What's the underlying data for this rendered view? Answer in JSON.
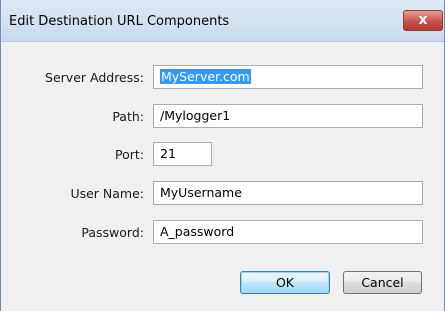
{
  "dialog": {
    "title": "Edit Destination URL Components",
    "close_label": "x"
  },
  "form": {
    "server_address": {
      "label": "Server Address:",
      "value": "MyServer.com"
    },
    "path": {
      "label": "Path:",
      "value": "/Mylogger1"
    },
    "port": {
      "label": "Port:",
      "value": "21"
    },
    "user_name": {
      "label": "User Name:",
      "value": "MyUsername"
    },
    "password": {
      "label": "Password:",
      "value": "A_password"
    }
  },
  "buttons": {
    "ok": "OK",
    "cancel": "Cancel"
  },
  "colors": {
    "selection": "#3399ff",
    "close_button": "#c75050",
    "default_button_border": "#3c7fb1"
  }
}
